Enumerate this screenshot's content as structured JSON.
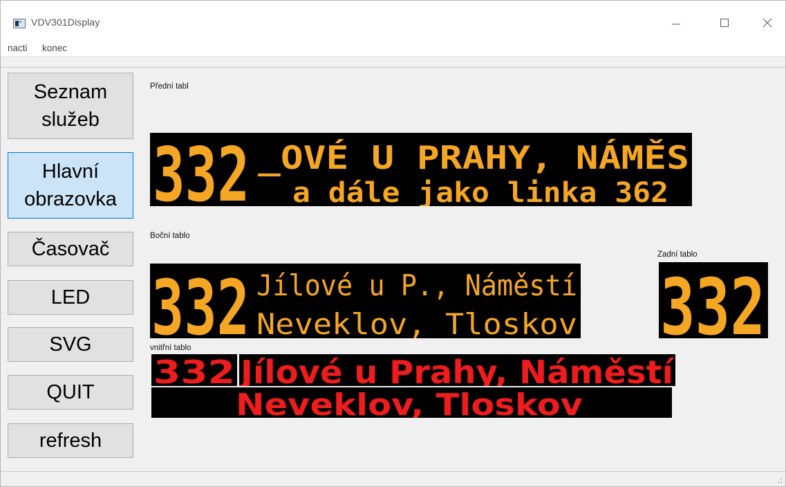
{
  "window": {
    "title": "VDV301Display"
  },
  "menu": {
    "items": [
      "nacti",
      "konec"
    ]
  },
  "sidebar": {
    "buttons": [
      {
        "line1": "Seznam",
        "line2": "služeb"
      },
      {
        "line1": "Hlavní",
        "line2": "obrazovka"
      },
      {
        "label": "Časovač"
      },
      {
        "label": "LED"
      },
      {
        "label": "SVG"
      },
      {
        "label": "QUIT"
      },
      {
        "label": "refresh"
      }
    ]
  },
  "labels": {
    "predni": "Přední tabl",
    "bocni": "Boční tablo",
    "zadni": "Zadní tablo",
    "vnitrni": "vnitřní tablo"
  },
  "predni_tablo": {
    "line": "332",
    "row1": "_OVÉ U PRAHY, NÁMĚS",
    "row2": "a dále jako linka 362",
    "color": "#f5a623"
  },
  "bocni_tablo": {
    "line": "332",
    "row1": "Jílové u P., Náměstí",
    "row2": "Neveklov, Tloskov",
    "color": "#f5a623"
  },
  "zadni_tablo": {
    "line": "332",
    "color": "#f5a623"
  },
  "vnitrni_tablo": {
    "line": "332",
    "row1": "Jílové u Prahy, Náměstí",
    "row2": "Neveklov, Tloskov",
    "color": "#ee1c1c"
  }
}
